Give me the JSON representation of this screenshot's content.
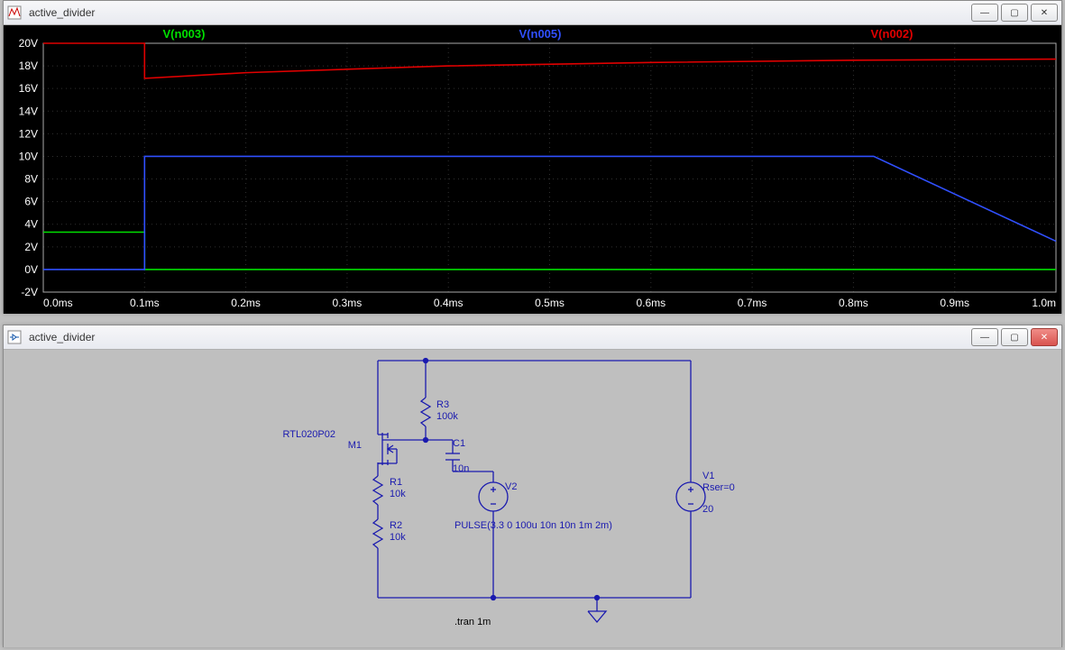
{
  "top_window": {
    "title": "active_divider"
  },
  "bottom_window": {
    "title": "active_divider"
  },
  "chart_data": {
    "type": "line",
    "xlabel": "",
    "ylabel": "",
    "y_ticks_labels": [
      "20V",
      "18V",
      "16V",
      "14V",
      "12V",
      "10V",
      "8V",
      "6V",
      "4V",
      "2V",
      "0V",
      "-2V"
    ],
    "x_ticks_labels": [
      "0.0ms",
      "0.1ms",
      "0.2ms",
      "0.3ms",
      "0.4ms",
      "0.5ms",
      "0.6ms",
      "0.7ms",
      "0.8ms",
      "0.9ms",
      "1.0m"
    ],
    "xlim": [
      0.0,
      1.0
    ],
    "ylim": [
      -2,
      20
    ],
    "series": [
      {
        "name": "V(n003)",
        "color": "#00e000",
        "points": [
          {
            "x": 0.0,
            "y": 3.3
          },
          {
            "x": 0.1,
            "y": 3.3
          },
          {
            "x": 0.10001,
            "y": 0.0
          },
          {
            "x": 1.0,
            "y": 0.0
          }
        ]
      },
      {
        "name": "V(n005)",
        "color": "#3050ff",
        "points": [
          {
            "x": 0.0,
            "y": 0.0
          },
          {
            "x": 0.1,
            "y": 0.0
          },
          {
            "x": 0.10001,
            "y": 10.0
          },
          {
            "x": 0.82,
            "y": 10.0
          },
          {
            "x": 1.0,
            "y": 2.5
          }
        ]
      },
      {
        "name": "V(n002)",
        "color": "#e00000",
        "points": [
          {
            "x": 0.0,
            "y": 20.0
          },
          {
            "x": 0.1,
            "y": 20.0
          },
          {
            "x": 0.10001,
            "y": 16.9
          },
          {
            "x": 0.2,
            "y": 17.4
          },
          {
            "x": 0.4,
            "y": 18.0
          },
          {
            "x": 0.6,
            "y": 18.3
          },
          {
            "x": 0.8,
            "y": 18.5
          },
          {
            "x": 1.0,
            "y": 18.6
          }
        ]
      }
    ]
  },
  "schematic": {
    "components": {
      "M1": {
        "label": "M1",
        "model": "RTL020P02"
      },
      "R1": {
        "label": "R1",
        "value": "10k"
      },
      "R2": {
        "label": "R2",
        "value": "10k"
      },
      "R3": {
        "label": "R3",
        "value": "100k"
      },
      "C1": {
        "label": "C1",
        "value": "10n"
      },
      "V1": {
        "label": "V1",
        "param": "Rser=0",
        "value": "20"
      },
      "V2": {
        "label": "V2",
        "value": "PULSE(3.3 0 100u 10n 10n 1m 2m)"
      }
    },
    "directive": ".tran 1m"
  }
}
